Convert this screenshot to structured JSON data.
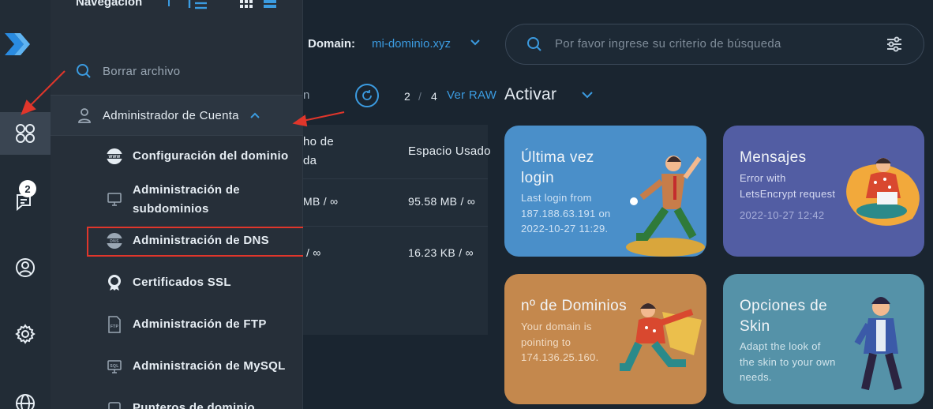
{
  "nav": {
    "title": "Navegación",
    "search_label": "Borrar archivo",
    "section_label": "Administrador de Cuenta",
    "items": [
      {
        "label": "Configuración del dominio",
        "icon": "www-icon"
      },
      {
        "label": "Administración de subdominios",
        "line1": "Administración de",
        "line2": "subdominios",
        "icon": "monitor-icon"
      },
      {
        "label": "Administración de DNS",
        "icon": "dns-icon"
      },
      {
        "label": "Certificados SSL",
        "icon": "ssl-badge-icon"
      },
      {
        "label": "Administración de FTP",
        "icon": "ftp-file-icon"
      },
      {
        "label": "Administración de MySQL",
        "icon": "sql-monitor-icon"
      },
      {
        "label": "Punteros de dominio",
        "icon": "pointer-icon"
      }
    ]
  },
  "rail": {
    "notification_count": "2"
  },
  "header": {
    "domain_label": "Domain:",
    "domain_value": "mi-dominio.xyz",
    "search_placeholder": "Por favor ingrese su criterio de búsqueda"
  },
  "toolbar": {
    "partial": "n",
    "page_current": "2",
    "page_sep": "/",
    "page_total": "4",
    "raw_label": "Ver RAW",
    "activate_label": "Activar"
  },
  "table": {
    "col1_line1": "ho de",
    "col1_line2": "da",
    "col2": "Espacio Usado",
    "rows": [
      {
        "c1": "MB  /  ∞",
        "c2": "95.58 MB  /  ∞"
      },
      {
        "c1": "/  ∞",
        "c2": "16.23 KB  /  ∞"
      }
    ]
  },
  "cards": {
    "login": {
      "title_line1": "Última vez",
      "title_line2": "login",
      "lines": [
        "Last login from",
        "187.188.63.191 on",
        "2022-10-27 11:29."
      ]
    },
    "messages": {
      "title": "Mensajes",
      "lines": [
        "Error with",
        "LetsEncrypt request"
      ],
      "date": "2022-10-27 12:42"
    },
    "domains": {
      "title": "nº de Dominios",
      "lines": [
        "Your domain is",
        "pointing to",
        "174.136.25.160."
      ]
    },
    "skin": {
      "title_line1": "Opciones de",
      "title_line2": "Skin",
      "lines": [
        "Adapt the look of",
        "the skin to your own",
        "needs."
      ]
    }
  },
  "colors": {
    "accent": "#3b9be0",
    "annotation": "#e0362b",
    "card_login": "#4a8fc9",
    "card_messages": "#525da3",
    "card_domains": "#c4884d",
    "card_skin": "#5592a8"
  }
}
